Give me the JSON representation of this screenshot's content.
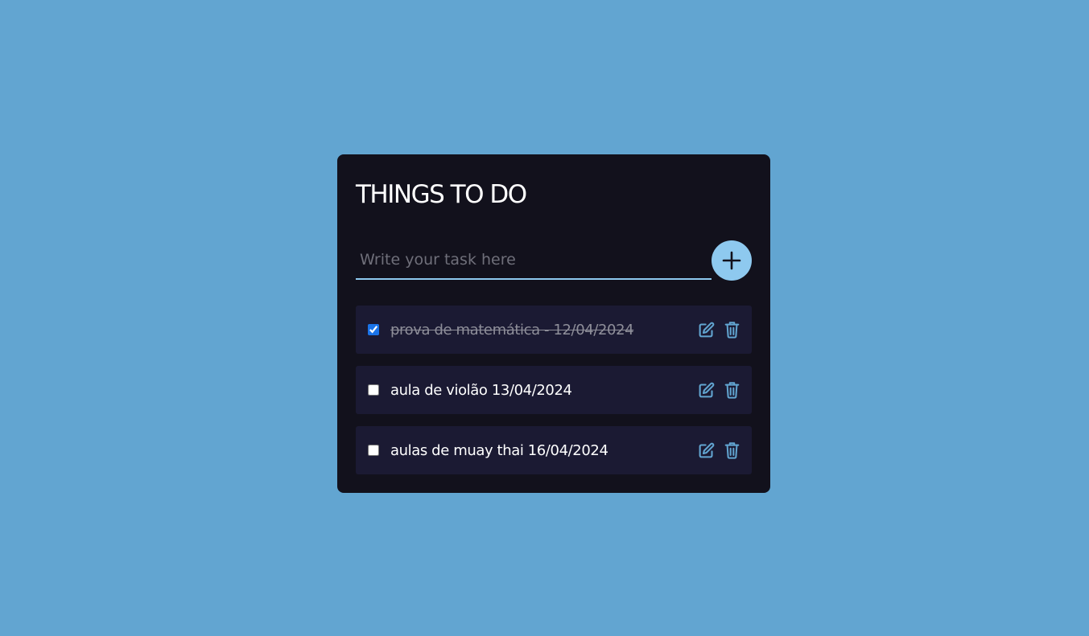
{
  "app": {
    "title": "THINGS TO DO"
  },
  "input": {
    "placeholder": "Write your task here",
    "value": ""
  },
  "add_button": {
    "icon": "plus-icon"
  },
  "tasks": [
    {
      "label": "prova de matemática - 12/04/2024",
      "done": true
    },
    {
      "label": "aula de violão 13/04/2024",
      "done": false
    },
    {
      "label": "aulas de muay thai 16/04/2024",
      "done": false
    }
  ],
  "icons": {
    "edit": "edit-icon",
    "delete": "trash-icon"
  },
  "colors": {
    "background": "#62a5d1",
    "card": "#12111c",
    "item": "#1b1a33",
    "accent": "#8ec9ef",
    "icon": "#62a5d1"
  }
}
